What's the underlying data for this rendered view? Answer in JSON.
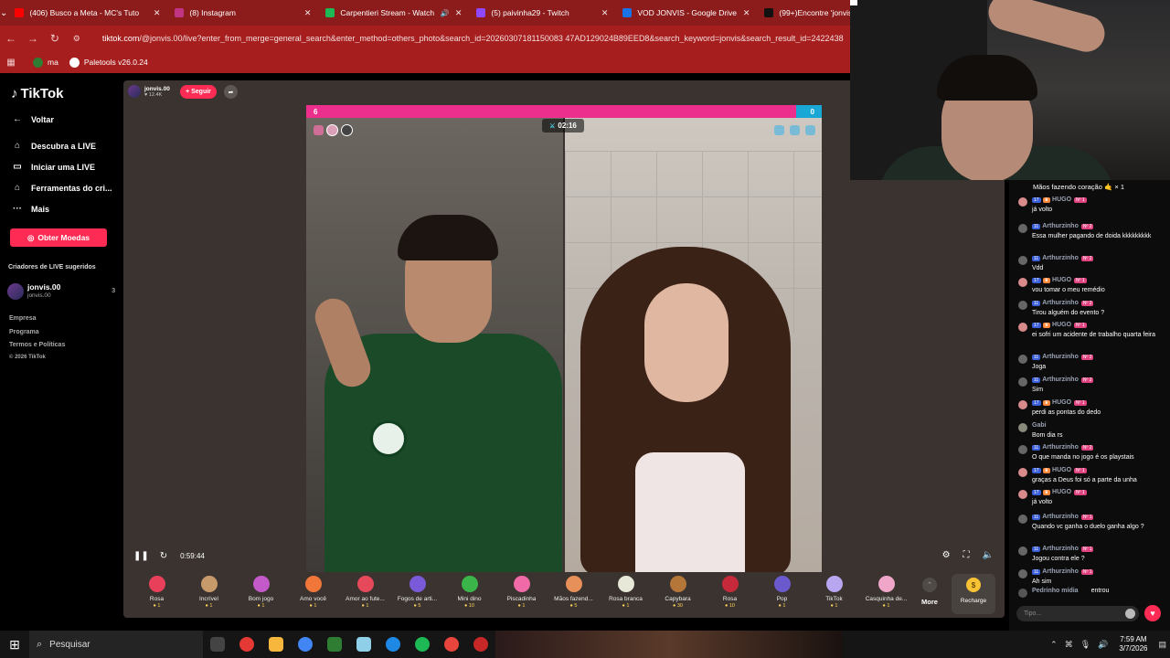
{
  "browser": {
    "tabs": [
      {
        "title": "(406) Busco a Meta - MC's Tuto",
        "color": "#ff0000"
      },
      {
        "title": "(8) Instagram",
        "color": "#c13584"
      },
      {
        "title": "Carpentieri Stream - Watch",
        "color": "#1db954",
        "speaker": "🔊"
      },
      {
        "title": "(5) paivinha29 - Twitch",
        "color": "#9146ff"
      },
      {
        "title": "VOD JONVIS - Google Drive",
        "color": "#1a73e8"
      },
      {
        "title": "(99+)Encontre 'jonvis' no",
        "color": "#111111"
      }
    ],
    "url_host": "tiktok.com",
    "url_rest": "/@jonvis.00/live?enter_from_merge=general_search&enter_method=others_photo&search_id=20260307181150083 47AD129024B89EED8&search_keyword=jonvis&search_result_id=2422438",
    "bookmarks": [
      {
        "label": "ma",
        "color": "#2e7d32"
      },
      {
        "label": "Paletools v26.0.24",
        "color": "#ffffff"
      }
    ]
  },
  "sidebar": {
    "brand": "TikTok",
    "back": "Voltar",
    "items": [
      {
        "label": "Descubra a LIVE",
        "icon": "⌂"
      },
      {
        "label": "Iniciar uma LIVE",
        "icon": "▭"
      },
      {
        "label": "Ferramentas do cri...",
        "icon": "⌂"
      },
      {
        "label": "Mais",
        "icon": "···"
      }
    ],
    "coins_button": "Obter Moedas",
    "suggested_title": "Criadores de LIVE sugeridos",
    "creator": {
      "name": "jonvis.00",
      "username": "jonvis.00",
      "count": "3"
    },
    "footer": [
      "Empresa",
      "Programa",
      "Termos e Políticas",
      "© 2026 TikTok"
    ]
  },
  "stream": {
    "streamer_name": "jonvis.00",
    "viewers": "12.4K",
    "follow_label": "+ Seguir",
    "battle_left_score": "6",
    "battle_right_score": "0",
    "battle_left_share": 0.95,
    "timer": "02:16",
    "elapsed": "0:59:44"
  },
  "gifts": [
    {
      "name": "Rosa",
      "price": "1",
      "color": "#e8405a"
    },
    {
      "name": "Incrível",
      "price": "1",
      "color": "#c79a6b"
    },
    {
      "name": "Bom jogo",
      "price": "1",
      "color": "#c45ac9"
    },
    {
      "name": "Amo você",
      "price": "1",
      "color": "#f0763a"
    },
    {
      "name": "Amor ao fute...",
      "price": "1",
      "color": "#e64a5a"
    },
    {
      "name": "Fogos de arti...",
      "price": "5",
      "color": "#7a5ad9"
    },
    {
      "name": "Mini dino",
      "price": "10",
      "color": "#3bb54a"
    },
    {
      "name": "Piscadinha",
      "price": "1",
      "color": "#f06aa8"
    },
    {
      "name": "Mãos fazend...",
      "price": "5",
      "color": "#e8905a"
    },
    {
      "name": "Rosa branca",
      "price": "1",
      "color": "#e8e8d8"
    },
    {
      "name": "Capybara",
      "price": "30",
      "color": "#b5763a"
    },
    {
      "name": "Rosa",
      "price": "10",
      "color": "#c62a3a"
    },
    {
      "name": "Pop",
      "price": "1",
      "color": "#6a5acd"
    },
    {
      "name": "TikTok",
      "price": "1",
      "color": "#b8a6f0"
    },
    {
      "name": "Casquinha de...",
      "price": "1",
      "color": "#f0a6c8"
    }
  ],
  "more_label": "More",
  "recharge_label": "Recharge",
  "chat": {
    "top_line": "Mãos fazendo coração 🤙 × 1",
    "messages": [
      {
        "user": "HUGO",
        "level": "17",
        "fan": "Nº 1",
        "mod": true,
        "text": "já volto",
        "avatar": "#d98a8a"
      },
      {
        "user": "Arthurzinho",
        "level": "11",
        "fan": "Nº 2",
        "mod": false,
        "text": "Essa mulher pagando de doida kkkkkkkkk",
        "avatar": "#666666"
      },
      {
        "user": "Arthurzinho",
        "level": "11",
        "fan": "Nº 2",
        "mod": false,
        "text": "Vdd",
        "avatar": "#666666"
      },
      {
        "user": "HUGO",
        "level": "17",
        "fan": "Nº 1",
        "mod": true,
        "text": "vou tomar o meu remédio",
        "avatar": "#d98a8a"
      },
      {
        "user": "Arthurzinho",
        "level": "11",
        "fan": "Nº 2",
        "mod": false,
        "text": "Tirou alguém do evento ?",
        "avatar": "#666666"
      },
      {
        "user": "HUGO",
        "level": "17",
        "fan": "Nº 1",
        "mod": true,
        "text": "ei sofri um acidente de trabalho quarta feira",
        "avatar": "#d98a8a"
      },
      {
        "user": "Arthurzinho",
        "level": "11",
        "fan": "Nº 2",
        "mod": false,
        "text": "Joga",
        "avatar": "#666666"
      },
      {
        "user": "Arthurzinho",
        "level": "11",
        "fan": "Nº 2",
        "mod": false,
        "text": "Sim",
        "avatar": "#666666"
      },
      {
        "user": "HUGO",
        "level": "17",
        "fan": "Nº 1",
        "mod": true,
        "text": "perdi as pontas do dedo",
        "avatar": "#d98a8a"
      },
      {
        "user": "Gabi",
        "level": "",
        "fan": "",
        "mod": false,
        "text": "Bom dia rs",
        "avatar": "#8a8a7a"
      },
      {
        "user": "Arthurzinho",
        "level": "11",
        "fan": "Nº 2",
        "mod": false,
        "text": "O que manda no jogo é os playstais",
        "avatar": "#666666"
      },
      {
        "user": "HUGO",
        "level": "17",
        "fan": "Nº 1",
        "mod": true,
        "text": "graças a Deus foi só a parte da unha",
        "avatar": "#d98a8a"
      },
      {
        "user": "HUGO",
        "level": "17",
        "fan": "Nº 1",
        "mod": true,
        "text": "já volto",
        "avatar": "#d98a8a"
      },
      {
        "user": "Arthurzinho",
        "level": "11",
        "fan": "Nº 1",
        "mod": false,
        "text": "Quando vc ganha o duelo ganha algo ?",
        "avatar": "#666666"
      },
      {
        "user": "Arthurzinho",
        "level": "11",
        "fan": "Nº 1",
        "mod": false,
        "text": "Jogou contra ele ?",
        "avatar": "#666666"
      },
      {
        "user": "Arthurzinho",
        "level": "11",
        "fan": "Nº 1",
        "mod": false,
        "text": "Ah sim",
        "avatar": "#666666"
      }
    ],
    "join": {
      "user": "Pedrinho mídia",
      "text": "entrou"
    },
    "input_placeholder": "Tipo..."
  },
  "taskbar": {
    "search_label": "Pesquisar",
    "time": "7:59 AM",
    "date": "3/7/2026"
  }
}
